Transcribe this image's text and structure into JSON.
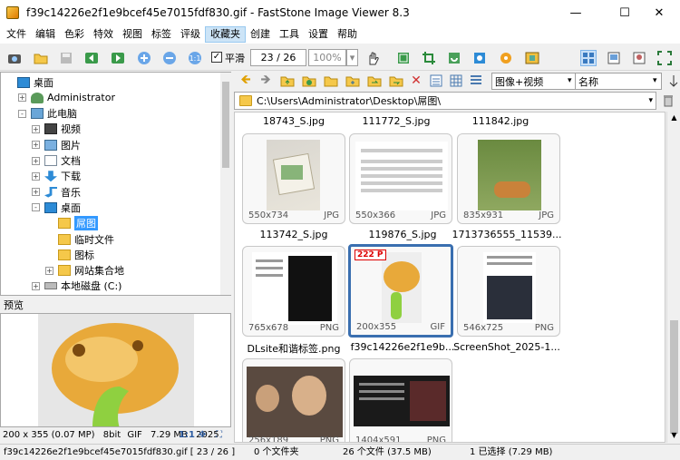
{
  "window": {
    "title": "f39c14226e2f1e9bcef45e7015fdf830.gif  -  FastStone Image Viewer 8.3",
    "minimize": "—",
    "maximize": "☐",
    "close": "✕"
  },
  "menu": [
    "文件",
    "编辑",
    "色彩",
    "特效",
    "视图",
    "标签",
    "评级",
    "收藏夹",
    "创建",
    "工具",
    "设置",
    "帮助"
  ],
  "toolbar": {
    "smooth_label": "平滑",
    "page": "23 / 26",
    "zoom": "100%"
  },
  "browser_toolbar": {
    "view_mode": "图像+视频",
    "sort": "名称"
  },
  "path": "C:\\Users\\Administrator\\Desktop\\屌图\\",
  "tree": [
    {
      "label": "桌面",
      "indent": 0,
      "exp": "",
      "icon": "desktop"
    },
    {
      "label": "Administrator",
      "indent": 1,
      "exp": "+",
      "icon": "user"
    },
    {
      "label": "此电脑",
      "indent": 1,
      "exp": "-",
      "icon": "pc"
    },
    {
      "label": "视频",
      "indent": 2,
      "exp": "+",
      "icon": "video"
    },
    {
      "label": "图片",
      "indent": 2,
      "exp": "+",
      "icon": "pic"
    },
    {
      "label": "文档",
      "indent": 2,
      "exp": "+",
      "icon": "doc"
    },
    {
      "label": "下载",
      "indent": 2,
      "exp": "+",
      "icon": "down"
    },
    {
      "label": "音乐",
      "indent": 2,
      "exp": "+",
      "icon": "music"
    },
    {
      "label": "桌面",
      "indent": 2,
      "exp": "-",
      "icon": "desktop"
    },
    {
      "label": "屌图",
      "indent": 3,
      "exp": "",
      "icon": "folder",
      "selected": true
    },
    {
      "label": "临时文件",
      "indent": 3,
      "exp": "",
      "icon": "folder"
    },
    {
      "label": "图标",
      "indent": 3,
      "exp": "",
      "icon": "folder"
    },
    {
      "label": "网站集合地",
      "indent": 3,
      "exp": "+",
      "icon": "folder"
    },
    {
      "label": "本地磁盘 (C:)",
      "indent": 2,
      "exp": "+",
      "icon": "disk"
    }
  ],
  "preview": {
    "header": "预览",
    "info_dims": "200 x 355 (0.07 MP)",
    "info_depth": "8bit",
    "info_type": "GIF",
    "info_size": "7.29 MB",
    "info_date": "2025",
    "ratio": "1:1"
  },
  "top_captions": [
    "18743_S.jpg",
    "111772_S.jpg",
    "111842.jpg"
  ],
  "thumbnails": [
    {
      "dims": "550x734",
      "type": "JPG",
      "caption": "113742_S.jpg"
    },
    {
      "dims": "550x366",
      "type": "JPG",
      "caption": "119876_S.jpg"
    },
    {
      "dims": "835x931",
      "type": "JPG",
      "caption": "1713736555_11539..."
    },
    {
      "dims": "765x678",
      "type": "PNG",
      "caption": "DLsite和谐标签.png"
    },
    {
      "dims": "200x355",
      "type": "GIF",
      "caption": "f39c14226e2f1e9b...",
      "badge": "222 P",
      "selected": true
    },
    {
      "dims": "546x725",
      "type": "PNG",
      "caption": "ScreenShot_2025-1..."
    },
    {
      "dims": "256x189",
      "type": "PNG",
      "caption": ""
    },
    {
      "dims": "1404x591",
      "type": "PNG",
      "caption": ""
    }
  ],
  "status": {
    "file": "f39c14226e2f1e9bcef45e7015fdf830.gif [ 23 / 26 ]",
    "folders": "0 个文件夹",
    "files": "26 个文件 (37.5 MB)",
    "selected": "1 已选择 (7.29 MB)"
  }
}
